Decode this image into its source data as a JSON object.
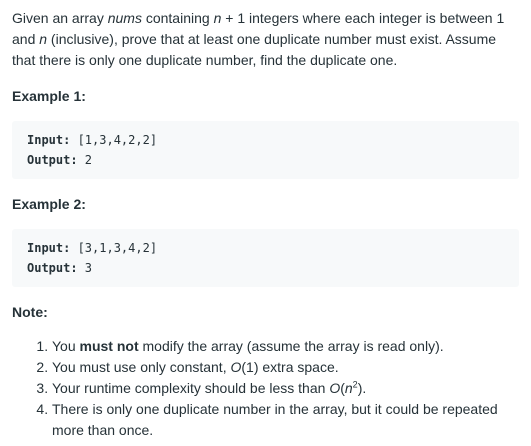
{
  "description": {
    "part1": "Given an array ",
    "nums": "nums",
    "part2": " containing ",
    "n1": "n",
    "part3": " + 1 integers where each integer is between 1 and ",
    "n2": "n",
    "part4": " (inclusive), prove that at least one duplicate number must exist. Assume that there is only one duplicate number, find the duplicate one."
  },
  "examples": [
    {
      "heading": "Example 1:",
      "input_label": "Input:",
      "input_value": " [1,3,4,2,2]",
      "output_label": "Output:",
      "output_value": " 2"
    },
    {
      "heading": "Example 2:",
      "input_label": "Input:",
      "input_value": " [3,1,3,4,2]",
      "output_label": "Output:",
      "output_value": " 3"
    }
  ],
  "note": {
    "heading": "Note:",
    "item1_a": "You ",
    "item1_bold": "must not",
    "item1_b": " modify the array (assume the array is read only).",
    "item2_a": "You must use only constant, ",
    "item2_o": "O",
    "item2_b": "(1) extra space.",
    "item3_a": "Your runtime complexity should be less than ",
    "item3_o": "O",
    "item3_b": "(",
    "item3_n": "n",
    "item3_sup": "2",
    "item3_c": ").",
    "item4": "There is only one duplicate number in the array, but it could be repeated more than once."
  }
}
